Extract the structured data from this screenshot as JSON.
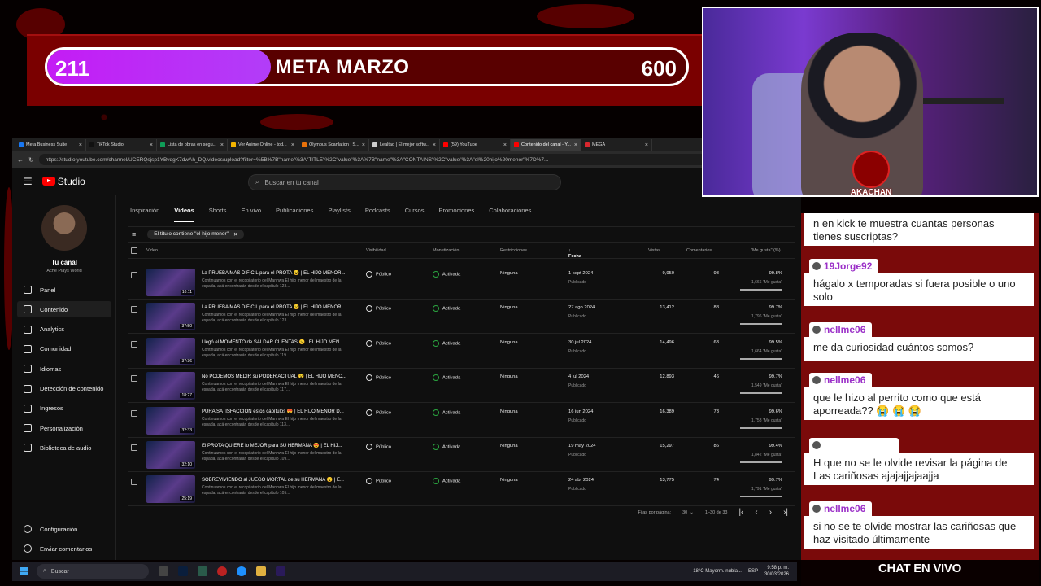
{
  "goal": {
    "current": "211",
    "title": "META MARZO",
    "max": "600",
    "progress": 0.35
  },
  "browser": {
    "tabs": [
      {
        "label": "Meta Business Suite",
        "color": "#1877f2"
      },
      {
        "label": "TikTok Studio",
        "color": "#111111"
      },
      {
        "label": "Lista de obras en segu...",
        "color": "#0f9d58"
      },
      {
        "label": "Ver Anime Online - tod...",
        "color": "#f4b400"
      },
      {
        "label": "Olympus Scanlation | S...",
        "color": "#e8710a"
      },
      {
        "label": "Lealtad | El mejor softw...",
        "color": "#cccccc"
      },
      {
        "label": "(59) YouTube",
        "color": "#ff0000"
      },
      {
        "label": "Contenido del canal - Y...",
        "color": "#ff0000",
        "active": true
      },
      {
        "label": "MEGA",
        "color": "#d9272e"
      }
    ],
    "url": "https://studio.youtube.com/channel/UCERQsjsp1YBvdgK7dwAh_DQ/videos/upload?filter=%5B%7B\"name\"%3A\"TITLE\"%2C\"value\"%3A%7B\"name\"%3A\"CONTAINS\"%2C\"value\"%3A\"el%20hijo%20menor\"%7D%7..."
  },
  "studio": {
    "logo": "Studio",
    "search_placeholder": "Buscar en tu canal",
    "channel_title": "Tu canal",
    "channel_name": "Ache Plays World",
    "sidebar": [
      {
        "label": "Panel"
      },
      {
        "label": "Contenido",
        "active": true
      },
      {
        "label": "Analytics"
      },
      {
        "label": "Comunidad"
      },
      {
        "label": "Idiomas"
      },
      {
        "label": "Detección de contenido"
      },
      {
        "label": "Ingresos"
      },
      {
        "label": "Personalización"
      },
      {
        "label": "Biblioteca de audio"
      }
    ],
    "sidebar_bottom": [
      {
        "label": "Configuración"
      },
      {
        "label": "Enviar comentarios"
      }
    ],
    "tabs": [
      "Inspiración",
      "Videos",
      "Shorts",
      "En vivo",
      "Publicaciones",
      "Playlists",
      "Podcasts",
      "Cursos",
      "Promociones",
      "Colaboraciones"
    ],
    "filter_chip": "El título contiene \"el hijo menor\"",
    "columns": {
      "video": "Video",
      "visibility": "Visibilidad",
      "monetization": "Monetización",
      "restrictions": "Restricciones",
      "date": "Fecha",
      "views": "Vistas",
      "comments": "Comentarios",
      "likes": "\"Me gusta\" (%)"
    },
    "rows": [
      {
        "title": "La PRUEBA MÁS DIFÍCIL para el PROTA 😮 | EL HIJO MENOR...",
        "desc": "Continuamos con el recopilatorio del Manhwa El hijo menor del maestro de la espada, acá encontrarán desde el capítulo 123...",
        "duration": "10:11",
        "visibility": "Público",
        "monetization": "Activada",
        "restrictions": "Ninguna",
        "date": "1 sept 2024",
        "status": "Publicado",
        "views": "9,950",
        "comments": "93",
        "likes_pct": "99.8%",
        "likes_count": "1,666 \"Me gusta\"",
        "ratio": 0.998
      },
      {
        "title": "La PRUEBA MÁS DIFÍCIL para el PROTA 😮 | EL HIJO MENOR...",
        "desc": "Continuamos con el recopilatorio del Manhwa El hijo menor del maestro de la espada, acá encontrarán desde el capítulo 123...",
        "duration": "37:50",
        "visibility": "Público",
        "monetization": "Activada",
        "restrictions": "Ninguna",
        "date": "27 ago 2024",
        "status": "Publicado",
        "views": "13,412",
        "comments": "88",
        "likes_pct": "99.7%",
        "likes_count": "1,796 \"Me gusta\"",
        "ratio": 0.997
      },
      {
        "title": "Llegó el MOMENTO de SALDAR CUENTAS 😮 | EL HIJO MEN...",
        "desc": "Continuamos con el recopilatorio del Manhwa El hijo menor del maestro de la espada, acá encontrarán desde el capítulo 119...",
        "duration": "37:36",
        "visibility": "Público",
        "monetization": "Activada",
        "restrictions": "Ninguna",
        "date": "30 jul 2024",
        "status": "Publicado",
        "views": "14,496",
        "comments": "63",
        "likes_pct": "99.5%",
        "likes_count": "1,664 \"Me gusta\"",
        "ratio": 0.995
      },
      {
        "title": "No PODEMOS MEDIR su PODER ACTUAL 😮 | EL HIJO MENO...",
        "desc": "Continuamos con el recopilatorio del Manhwa El hijo menor del maestro de la espada, acá encontrarán desde el capítulo 117...",
        "duration": "18:27",
        "visibility": "Público",
        "monetization": "Activada",
        "restrictions": "Ninguna",
        "date": "4 jul 2024",
        "status": "Publicado",
        "views": "12,893",
        "comments": "46",
        "likes_pct": "99.7%",
        "likes_count": "1,549 \"Me gusta\"",
        "ratio": 0.997
      },
      {
        "title": "PURA SATISFACCIÓN estos capítulos 😍 | EL HIJO MENOR D...",
        "desc": "Continuamos con el recopilatorio del Manhwa El hijo menor del maestro de la espada, acá encontrarán desde el capítulo 113...",
        "duration": "32:33",
        "visibility": "Público",
        "monetization": "Activada",
        "restrictions": "Ninguna",
        "date": "16 jun 2024",
        "status": "Publicado",
        "views": "16,389",
        "comments": "73",
        "likes_pct": "99.6%",
        "likes_count": "1,758 \"Me gusta\"",
        "ratio": 0.996
      },
      {
        "title": "El PROTA QUIERE lo MEJOR para SU HERMANA 😍 | EL HIJ...",
        "desc": "Continuamos con el recopilatorio del Manhwa El hijo menor del maestro de la espada, acá encontrarán desde el capítulo 109...",
        "duration": "32:10",
        "visibility": "Público",
        "monetization": "Activada",
        "restrictions": "Ninguna",
        "date": "19 may 2024",
        "status": "Publicado",
        "views": "15,297",
        "comments": "86",
        "likes_pct": "99.4%",
        "likes_count": "1,842 \"Me gusta\"",
        "ratio": 0.994
      },
      {
        "title": "SOBREVIVIENDO al JUEGO MORTAL de su HERMANA 😮 | E...",
        "desc": "Continuamos con el recopilatorio del Manhwa El hijo menor del maestro de la espada, acá encontrarán desde el capítulo 105...",
        "duration": "25:19",
        "visibility": "Público",
        "monetization": "Activada",
        "restrictions": "Ninguna",
        "date": "24 abr 2024",
        "status": "Publicado",
        "views": "13,775",
        "comments": "74",
        "likes_pct": "99.7%",
        "likes_count": "1,791 \"Me gusta\"",
        "ratio": 0.997
      }
    ],
    "pager": {
      "rows_label": "Filas por página:",
      "rows_value": "30",
      "range": "1–30 de 33"
    }
  },
  "taskbar": {
    "search": "Buscar",
    "weather": "18°C  Mayorm. nubla...",
    "lang": "ESP",
    "time": "9:58 p. m.",
    "date": "30/03/2026"
  },
  "overlay": {
    "badge": "AKACHAN"
  },
  "chat": {
    "footer": "CHAT EN VIVO",
    "messages": [
      {
        "user": "",
        "text": "n en kick te muestra cuantas personas tienes suscriptas?"
      },
      {
        "user": "19Jorge92",
        "text": "hágalo x temporadas si fuera posible o uno solo"
      },
      {
        "user": "nellme06",
        "text": "me da curiosidad cuántos somos?"
      },
      {
        "user": "nellme06",
        "text": "que le hizo al perrito como que está aporreada?? 😭 😭 😭"
      },
      {
        "user": "",
        "text": "H que no se le olvide revisar la página de Las cariñosas ajajajjajaajja"
      },
      {
        "user": "nellme06",
        "text": "si no se te olvide mostrar las cariñosas que haz visitado últimamente"
      }
    ]
  }
}
